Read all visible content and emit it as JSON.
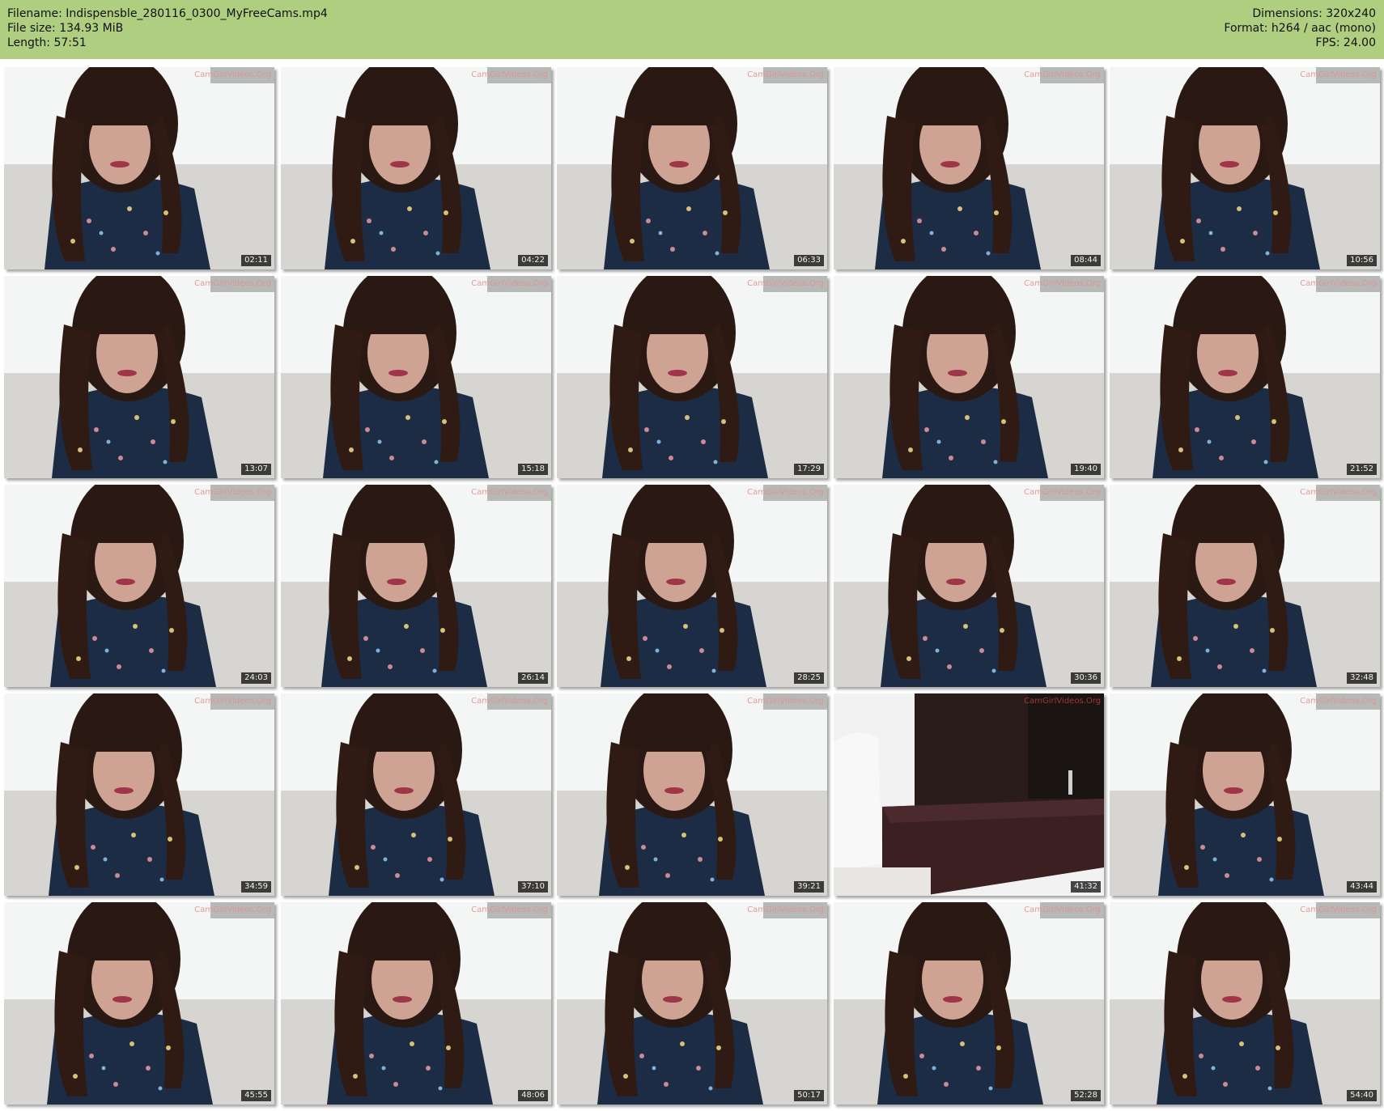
{
  "header": {
    "filename": "Filename: Indispensble_280116_0300_MyFreeCams.mp4",
    "filesize": "File size: 134.93 MiB",
    "length": "Length: 57:51",
    "dimensions": "Dimensions: 320x240",
    "format": "Format: h264 / aac (mono)",
    "fps": "FPS: 24.00"
  },
  "watermark": "CamGirlVideos.Org",
  "thumbnails": [
    {
      "time": "02:11",
      "scene": "person"
    },
    {
      "time": "04:22",
      "scene": "person"
    },
    {
      "time": "06:33",
      "scene": "person"
    },
    {
      "time": "08:44",
      "scene": "person"
    },
    {
      "time": "10:56",
      "scene": "person"
    },
    {
      "time": "13:07",
      "scene": "person"
    },
    {
      "time": "15:18",
      "scene": "person"
    },
    {
      "time": "17:29",
      "scene": "person"
    },
    {
      "time": "19:40",
      "scene": "person"
    },
    {
      "time": "21:52",
      "scene": "person"
    },
    {
      "time": "24:03",
      "scene": "person"
    },
    {
      "time": "26:14",
      "scene": "person"
    },
    {
      "time": "28:25",
      "scene": "person"
    },
    {
      "time": "30:36",
      "scene": "person"
    },
    {
      "time": "32:48",
      "scene": "person"
    },
    {
      "time": "34:59",
      "scene": "person"
    },
    {
      "time": "37:10",
      "scene": "person"
    },
    {
      "time": "39:21",
      "scene": "person"
    },
    {
      "time": "41:32",
      "scene": "empty-room"
    },
    {
      "time": "43:44",
      "scene": "person"
    },
    {
      "time": "45:55",
      "scene": "person"
    },
    {
      "time": "48:06",
      "scene": "person"
    },
    {
      "time": "50:17",
      "scene": "person"
    },
    {
      "time": "52:28",
      "scene": "person"
    },
    {
      "time": "54:40",
      "scene": "person"
    }
  ]
}
